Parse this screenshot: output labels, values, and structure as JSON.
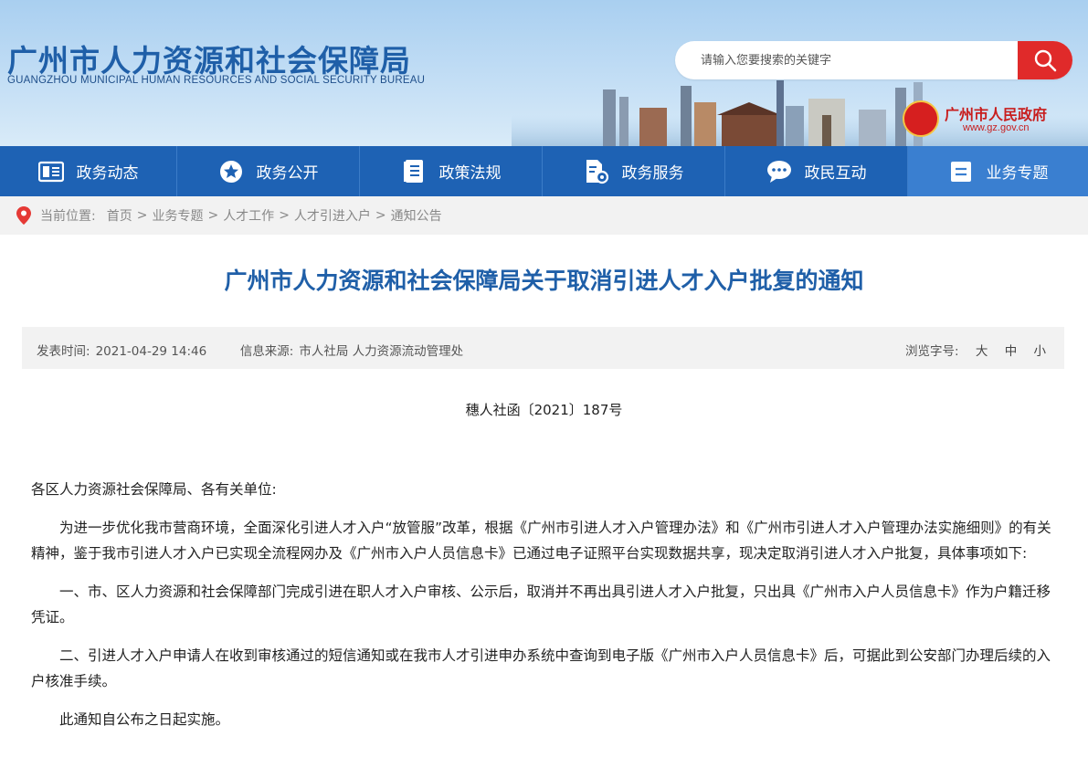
{
  "header": {
    "title": "广州市人力资源和社会保障局",
    "subtitle": "GUANGZHOU MUNICIPAL HUMAN RESOURCES AND SOCIAL SECURITY BUREAU",
    "gov_name": "广州市人民政府",
    "gov_url": "www.gz.gov.cn"
  },
  "search": {
    "placeholder": "请输入您要搜索的关键字",
    "button_icon": "search-icon"
  },
  "nav": [
    {
      "label": "政务动态",
      "icon": "newspaper-icon"
    },
    {
      "label": "政务公开",
      "icon": "star-badge-icon"
    },
    {
      "label": "政策法规",
      "icon": "book-icon"
    },
    {
      "label": "政务服务",
      "icon": "document-gear-icon"
    },
    {
      "label": "政民互动",
      "icon": "chat-bubble-icon"
    },
    {
      "label": "业务专题",
      "icon": "list-card-icon"
    }
  ],
  "breadcrumb": {
    "label": "当前位置:",
    "items": [
      "首页",
      "业务专题",
      "人才工作",
      "人才引进入户",
      "通知公告"
    ],
    "separator": ">"
  },
  "article": {
    "title": "广州市人力资源和社会保障局关于取消引进人才入户批复的通知",
    "publish_label": "发表时间:",
    "publish_time": "2021-04-29 14:46",
    "source_label": "信息来源:",
    "source": "市人社局 人力资源流动管理处",
    "font_size_label": "浏览字号:",
    "font_sizes": [
      "大",
      "中",
      "小"
    ],
    "doc_number": "穗人社函〔2021〕187号",
    "paragraphs": [
      "各区人力资源社会保障局、各有关单位:",
      "为进一步优化我市营商环境，全面深化引进人才入户“放管服”改革，根据《广州市引进人才入户管理办法》和《广州市引进人才入户管理办法实施细则》的有关精神，鉴于我市引进人才入户已实现全流程网办及《广州市入户人员信息卡》已通过电子证照平台实现数据共享，现决定取消引进人才入户批复，具体事项如下:",
      "一、市、区人力资源和社会保障部门完成引进在职人才入户审核、公示后，取消并不再出具引进人才入户批复，只出具《广州市入户人员信息卡》作为户籍迁移凭证。",
      "二、引进人才入户申请人在收到审核通过的短信通知或在我市人才引进申办系统中查询到电子版《广州市入户人员信息卡》后，可据此到公安部门办理后续的入户核准手续。",
      "此通知自公布之日起实施。"
    ]
  },
  "colors": {
    "brand_blue": "#1f5fa8",
    "nav_blue": "#1e62b4",
    "nav_active": "#3a7fd0",
    "search_red": "#e02a2a",
    "gov_red": "#c81e1e"
  }
}
